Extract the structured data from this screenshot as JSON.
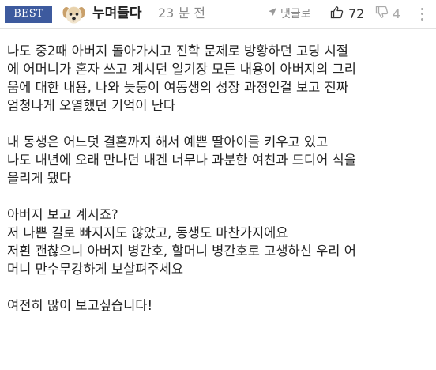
{
  "comment": {
    "badge": "BEST",
    "author": "누며들다",
    "time": "23 분 전",
    "reply_label": "댓글로",
    "likes": "72",
    "dislikes": "4",
    "icons": {
      "avatar": "puppy-avatar-icon",
      "reply": "reply-arrow-icon",
      "like": "thumbs-up-icon",
      "dislike": "thumbs-down-icon",
      "more": "more-vertical-icon"
    },
    "paragraphs": [
      [
        "나도 중2때 아버지 돌아가시고 진학 문제로 방황하던 고딩 시절",
        "에 어머니가 혼자 쓰고 계시던 일기장 모든 내용이 아버지의 그리",
        "움에 대한 내용, 나와 늦둥이 여동생의 성장 과정인걸 보고 진짜",
        "엄청나게 오열했던 기억이 난다"
      ],
      [
        "내 동생은 어느덧 결혼까지 해서 예쁜 딸아이를 키우고 있고",
        "나도 내년에 오래 만나던 내겐 너무나 과분한 여친과 드디어 식을",
        "올리게 됐다"
      ],
      [
        "아버지 보고 계시죠?",
        "저 나쁜 길로 빠지지도 않았고, 동생도 마찬가지에요",
        "저흰 괜찮으니 아버지 병간호, 할머니 병간호로 고생하신 우리 어",
        "머니 만수무강하게 보살펴주세요"
      ],
      [
        "여전히 많이 보고싶습니다!"
      ]
    ]
  },
  "colors": {
    "badge_bg": "#3d5a9e",
    "text": "#222222",
    "muted": "#888888"
  }
}
